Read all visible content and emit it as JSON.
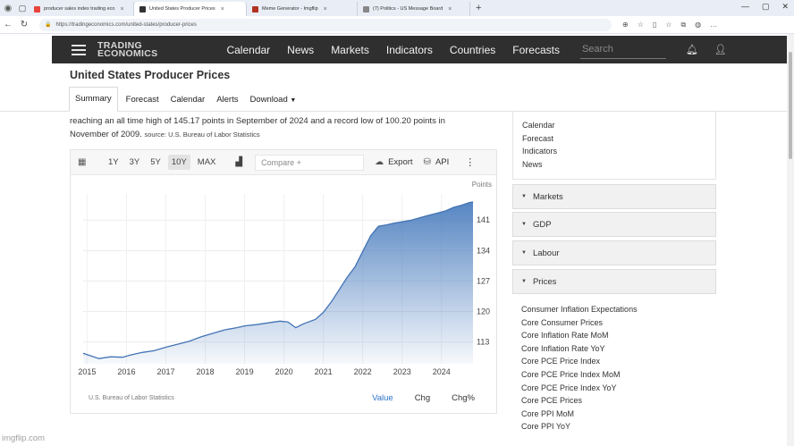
{
  "browser": {
    "tabs": [
      {
        "label": "producer sales index trading eco",
        "color": "#e9433b",
        "active": false
      },
      {
        "label": "United States Producer Prices",
        "color": "#333333",
        "active": true
      },
      {
        "label": "Meme Generator - Imgflip",
        "color": "#b23121",
        "active": false
      },
      {
        "label": "(7) Politics - US Message Board",
        "color": "#888888",
        "active": false
      }
    ],
    "url": "https://tradingeconomics.com/united-states/producer-prices"
  },
  "site": {
    "brand_line1": "TRADING",
    "brand_line2": "ECONOMICS",
    "nav": [
      "Calendar",
      "News",
      "Markets",
      "Indicators",
      "Countries",
      "Forecasts"
    ],
    "search_placeholder": "Search"
  },
  "page": {
    "title": "United States Producer Prices",
    "subnav": [
      "Summary",
      "Forecast",
      "Calendar",
      "Alerts",
      "Download"
    ],
    "description_line1": "reaching an all time high of 145.17 points in September of 2024 and a record low of 100.20 points in",
    "description_line2": "November of 2009.",
    "source_label": "source: U.S. Bureau of Labor Statistics"
  },
  "chart_toolbar": {
    "ranges": [
      "1Y",
      "3Y",
      "5Y",
      "10Y",
      "MAX"
    ],
    "active_range": "10Y",
    "compare_placeholder": "Compare +",
    "export_label": "Export",
    "api_label": "API"
  },
  "chart_footer": {
    "source": "U.S. Bureau of Labor Statistics",
    "modes": [
      "Value",
      "Chg",
      "Chg%"
    ],
    "active_mode": "Value"
  },
  "chart_data": {
    "type": "area",
    "ylabel": "Points",
    "yticks": [
      113,
      120,
      127,
      134,
      141
    ],
    "ylim": [
      108,
      147
    ],
    "xticks": [
      "2015",
      "2016",
      "2017",
      "2018",
      "2019",
      "2020",
      "2021",
      "2022",
      "2023",
      "2024"
    ],
    "xlim": [
      2014.9,
      2024.8
    ],
    "grid": true,
    "color": "#4d7fbf",
    "x": [
      2014.9,
      2015.1,
      2015.3,
      2015.6,
      2015.9,
      2016.1,
      2016.4,
      2016.7,
      2017.0,
      2017.3,
      2017.6,
      2017.9,
      2018.2,
      2018.5,
      2018.8,
      2019.0,
      2019.3,
      2019.6,
      2019.9,
      2020.1,
      2020.3,
      2020.5,
      2020.8,
      2021.0,
      2021.2,
      2021.4,
      2021.6,
      2021.8,
      2022.0,
      2022.2,
      2022.4,
      2022.6,
      2022.8,
      2023.0,
      2023.2,
      2023.4,
      2023.6,
      2023.9,
      2024.1,
      2024.3,
      2024.5,
      2024.7,
      2024.8
    ],
    "y": [
      110.4,
      109.8,
      109.2,
      109.6,
      109.5,
      110.0,
      110.6,
      111.0,
      111.8,
      112.5,
      113.2,
      114.2,
      115.0,
      115.8,
      116.3,
      116.7,
      117.0,
      117.4,
      117.8,
      117.6,
      116.3,
      117.2,
      118.2,
      119.8,
      122.2,
      125.0,
      127.8,
      130.2,
      133.8,
      137.4,
      139.6,
      139.9,
      140.3,
      140.6,
      140.9,
      141.4,
      141.9,
      142.6,
      143.1,
      143.9,
      144.4,
      145.0,
      145.17
    ]
  },
  "sidebar": {
    "top_links": [
      "Calendar",
      "Forecast",
      "Indicators",
      "News"
    ],
    "sections": [
      "Markets",
      "GDP",
      "Labour",
      "Prices"
    ],
    "prices_items": [
      "Consumer Inflation Expectations",
      "Core Consumer Prices",
      "Core Inflation Rate MoM",
      "Core Inflation Rate YoY",
      "Core PCE Price Index",
      "Core PCE Price Index MoM",
      "Core PCE Price Index YoY",
      "Core PCE Prices",
      "Core PPI MoM",
      "Core PPI YoY"
    ]
  },
  "watermark": "imgflip.com"
}
